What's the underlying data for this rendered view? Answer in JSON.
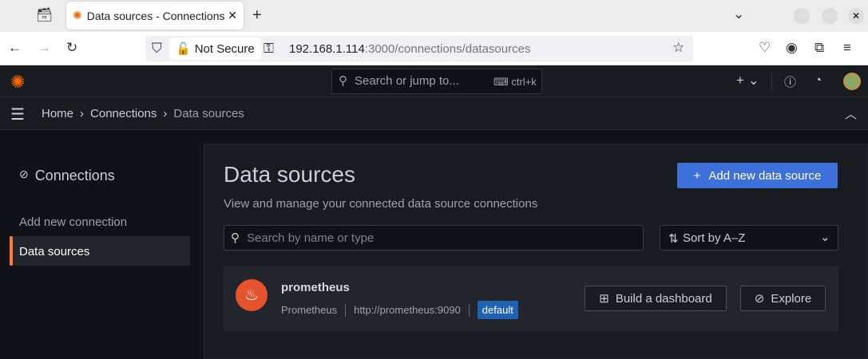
{
  "browser": {
    "tab_title": "Data sources - Connections",
    "new_tab": "+",
    "security": "Not Secure",
    "url_host": "192.168.1.114",
    "url_path": ":3000/connections/datasources"
  },
  "topbar": {
    "search_placeholder": "Search or jump to...",
    "shortcut": "ctrl+k",
    "add": "+"
  },
  "breadcrumb": {
    "items": [
      "Home",
      "Connections",
      "Data sources"
    ]
  },
  "sidebar": {
    "title": "Connections",
    "items": [
      {
        "label": "Add new connection"
      },
      {
        "label": "Data sources",
        "active": true
      }
    ]
  },
  "main": {
    "title": "Data sources",
    "subtitle": "View and manage your connected data source connections",
    "add_button": "Add new data source",
    "search_placeholder": "Search by name or type",
    "sort": "Sort by A–Z"
  },
  "datasources": [
    {
      "name": "prometheus",
      "type": "Prometheus",
      "url": "http://prometheus:9090",
      "badge": "default",
      "actions": [
        "Build a dashboard",
        "Explore"
      ]
    }
  ],
  "colors": {
    "accent": "#3d71d9",
    "brand": "#f46800",
    "badge": "#1f62b3",
    "active_bar": "#ff7a35"
  }
}
